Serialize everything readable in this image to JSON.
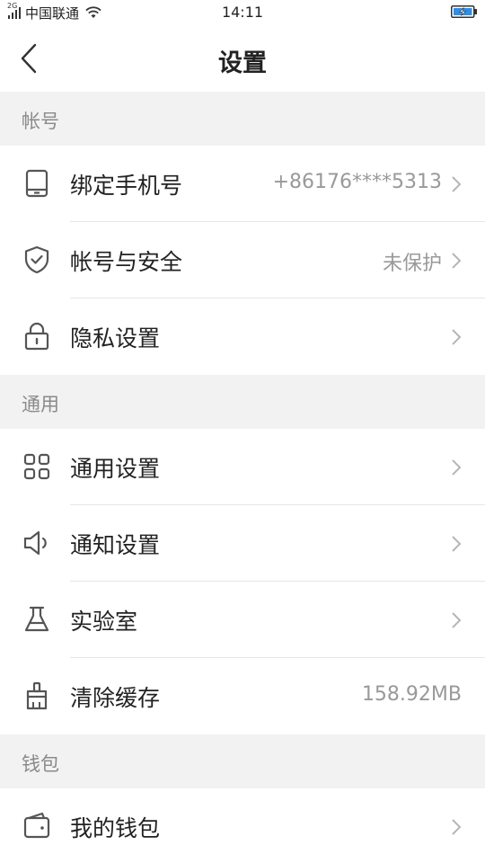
{
  "status_bar": {
    "network": "2G",
    "carrier": "中国联通",
    "time": "14:11",
    "signal_icon": "signal-icon",
    "wifi_icon": "wifi-icon",
    "battery_icon": "battery-charging-icon"
  },
  "navbar": {
    "title": "设置",
    "back_icon": "back-chevron-icon"
  },
  "sections": {
    "account": {
      "header": "帐号",
      "items": [
        {
          "label": "绑定手机号",
          "value": "+86176****5313",
          "icon": "phone-icon"
        },
        {
          "label": "帐号与安全",
          "value": "未保护",
          "icon": "shield-icon"
        },
        {
          "label": "隐私设置",
          "value": "",
          "icon": "lock-icon"
        }
      ]
    },
    "general": {
      "header": "通用",
      "items": [
        {
          "label": "通用设置",
          "value": "",
          "icon": "grid-icon"
        },
        {
          "label": "通知设置",
          "value": "",
          "icon": "speaker-icon"
        },
        {
          "label": "实验室",
          "value": "",
          "icon": "flask-icon"
        },
        {
          "label": "清除缓存",
          "value": "158.92MB",
          "icon": "brush-icon"
        }
      ]
    },
    "wallet": {
      "header": "钱包",
      "items": [
        {
          "label": "我的钱包",
          "value": "",
          "icon": "wallet-icon"
        }
      ]
    }
  },
  "colors": {
    "section_bg": "#f2f2f2",
    "text_primary": "#222222",
    "text_secondary": "#999999",
    "icon_stroke": "#555555"
  }
}
